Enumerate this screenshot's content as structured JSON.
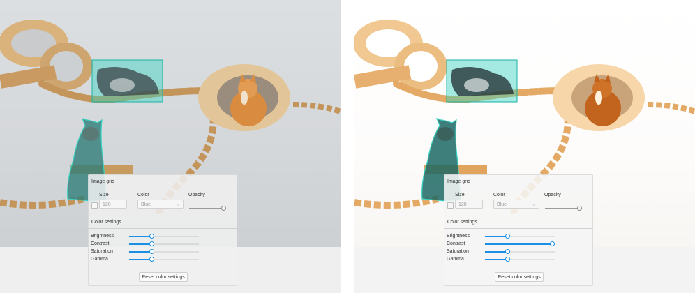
{
  "viewers": [
    {
      "panel": {
        "image_grid_title": "Image grid",
        "size_label": "Size",
        "color_label": "Color",
        "opacity_label": "Opacity",
        "size_value": "120",
        "color_value": "Blue",
        "opacity": 0.95,
        "color_settings_title": "Color settings",
        "sliders": [
          {
            "label": "Brightness",
            "value": 0.32
          },
          {
            "label": "Contrast",
            "value": 0.32
          },
          {
            "label": "Saturation",
            "value": 0.32
          },
          {
            "label": "Gamma",
            "value": 0.32
          }
        ],
        "reset_label": "Reset color settings"
      }
    },
    {
      "panel": {
        "image_grid_title": "Image grid",
        "size_label": "Size",
        "color_label": "Color",
        "opacity_label": "Opacity",
        "size_value": "120",
        "color_value": "Blue",
        "opacity": 0.95,
        "color_settings_title": "Color settings",
        "sliders": [
          {
            "label": "Brightness",
            "value": 0.32
          },
          {
            "label": "Contrast",
            "value": 0.96
          },
          {
            "label": "Saturation",
            "value": 0.32
          },
          {
            "label": "Gamma",
            "value": 0.32
          }
        ],
        "reset_label": "Reset color settings"
      }
    }
  ],
  "colors": {
    "accent": "#1a8fe3",
    "annotation_fill": "#37d2c2",
    "annotation_stroke": "#19b3a4"
  }
}
